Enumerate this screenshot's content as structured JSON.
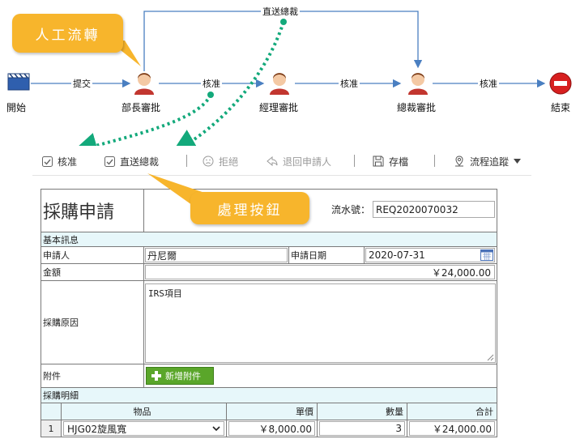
{
  "flow": {
    "nodes": [
      {
        "id": "start",
        "label": "開始",
        "icon": "start-icon"
      },
      {
        "id": "dept",
        "label": "部長審批",
        "icon": "user-icon"
      },
      {
        "id": "mgr",
        "label": "經理審批",
        "icon": "user-icon"
      },
      {
        "id": "ceo",
        "label": "總裁審批",
        "icon": "user-icon"
      },
      {
        "id": "end",
        "label": "結束",
        "icon": "stop-icon"
      }
    ],
    "edges": {
      "submit": "提交",
      "approve1": "核准",
      "approve2": "核准",
      "approve3": "核准",
      "direct": "直送總裁"
    },
    "callout_manual": "人工流轉",
    "callout_buttons": "處理按鈕",
    "colors": {
      "edge": "#4a7fc1",
      "dashed": "#13a97b",
      "callout": "#f7b52c",
      "stop": "#d71f1f"
    }
  },
  "toolbar": {
    "approve": "核准",
    "direct": "直送總裁",
    "reject": "拒絕",
    "return": "退回申請人",
    "save": "存檔",
    "trace": "流程追蹤"
  },
  "form": {
    "title": "採購申請",
    "serial_label": "流水號：",
    "serial_value": "REQ2020070032",
    "section_basic": "基本訊息",
    "applicant_label": "申請人",
    "applicant_value": "丹尼爾",
    "date_label": "申請日期",
    "date_value": "2020-07-31",
    "amount_label": "金額",
    "amount_value": "￥24,000.00",
    "reason_label": "採購原因",
    "reason_value": "IRS項目",
    "attach_label": "附件",
    "attach_button": "新增附件",
    "section_detail": "採購明細",
    "table": {
      "headers": [
        "物品",
        "單價",
        "數量",
        "合計"
      ],
      "rows": [
        {
          "no": "1",
          "item": "HJG02旋風寬",
          "price": "￥8,000.00",
          "qty": "3",
          "total": "￥24,000.00"
        }
      ]
    }
  }
}
